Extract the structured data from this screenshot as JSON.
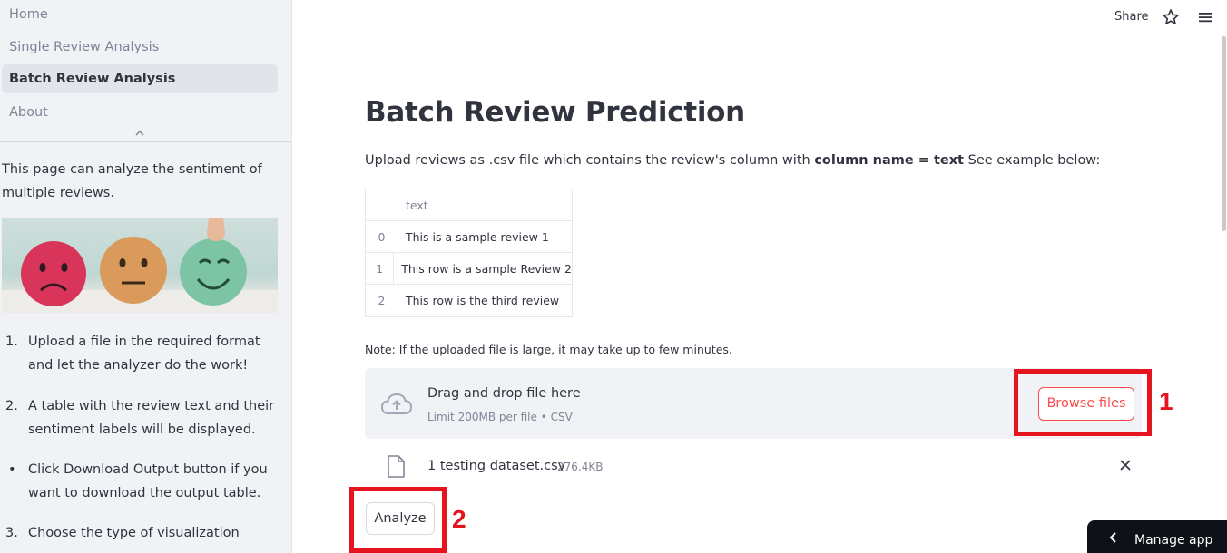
{
  "sidebar": {
    "nav": [
      {
        "label": "Home",
        "active": false
      },
      {
        "label": "Single Review Analysis",
        "active": false
      },
      {
        "label": "Batch Review Analysis",
        "active": true
      },
      {
        "label": "About",
        "active": false
      }
    ],
    "description": "This page can analyze the sentiment of multiple reviews.",
    "steps": [
      {
        "marker": "1.",
        "text": "Upload a file in the required format and let the analyzer do the work!"
      },
      {
        "marker": "2.",
        "text": "A table with the review text and their sentiment labels will be displayed."
      },
      {
        "marker": "•",
        "text": "Click Download Output button if you want to download the output table."
      },
      {
        "marker": "3.",
        "text": "Choose the type of visualization"
      }
    ]
  },
  "topbar": {
    "share_label": "Share",
    "icons": [
      "star-icon",
      "hamburger-menu-icon"
    ]
  },
  "main": {
    "title": "Batch Review Prediction",
    "desc_prefix": "Upload reviews as .csv file which contains the review's column with ",
    "desc_bold": "column name = text",
    "desc_suffix": " See example below:",
    "table": {
      "header": "text",
      "rows": [
        {
          "index": "0",
          "text": "This is a sample review 1"
        },
        {
          "index": "1",
          "text": "This row is a sample Review 2"
        },
        {
          "index": "2",
          "text": "This row is the third review"
        }
      ]
    },
    "note": "Note: If the uploaded file is large, it may take up to few minutes.",
    "uploader": {
      "title": "Drag and drop file here",
      "subtitle": "Limit 200MB per file • CSV",
      "browse_label": "Browse files"
    },
    "file": {
      "name": "1 testing dataset.csv",
      "size": "276.4KB"
    },
    "analyze_label": "Analyze"
  },
  "annotations": {
    "step1": "1",
    "step2": "2",
    "color": "#e5141f"
  },
  "manage_app_label": "Manage app",
  "colors": {
    "primary": "#ff4b4b",
    "sidebar_bg": "#f0f2f6",
    "text": "#31333f",
    "muted": "#808495"
  }
}
